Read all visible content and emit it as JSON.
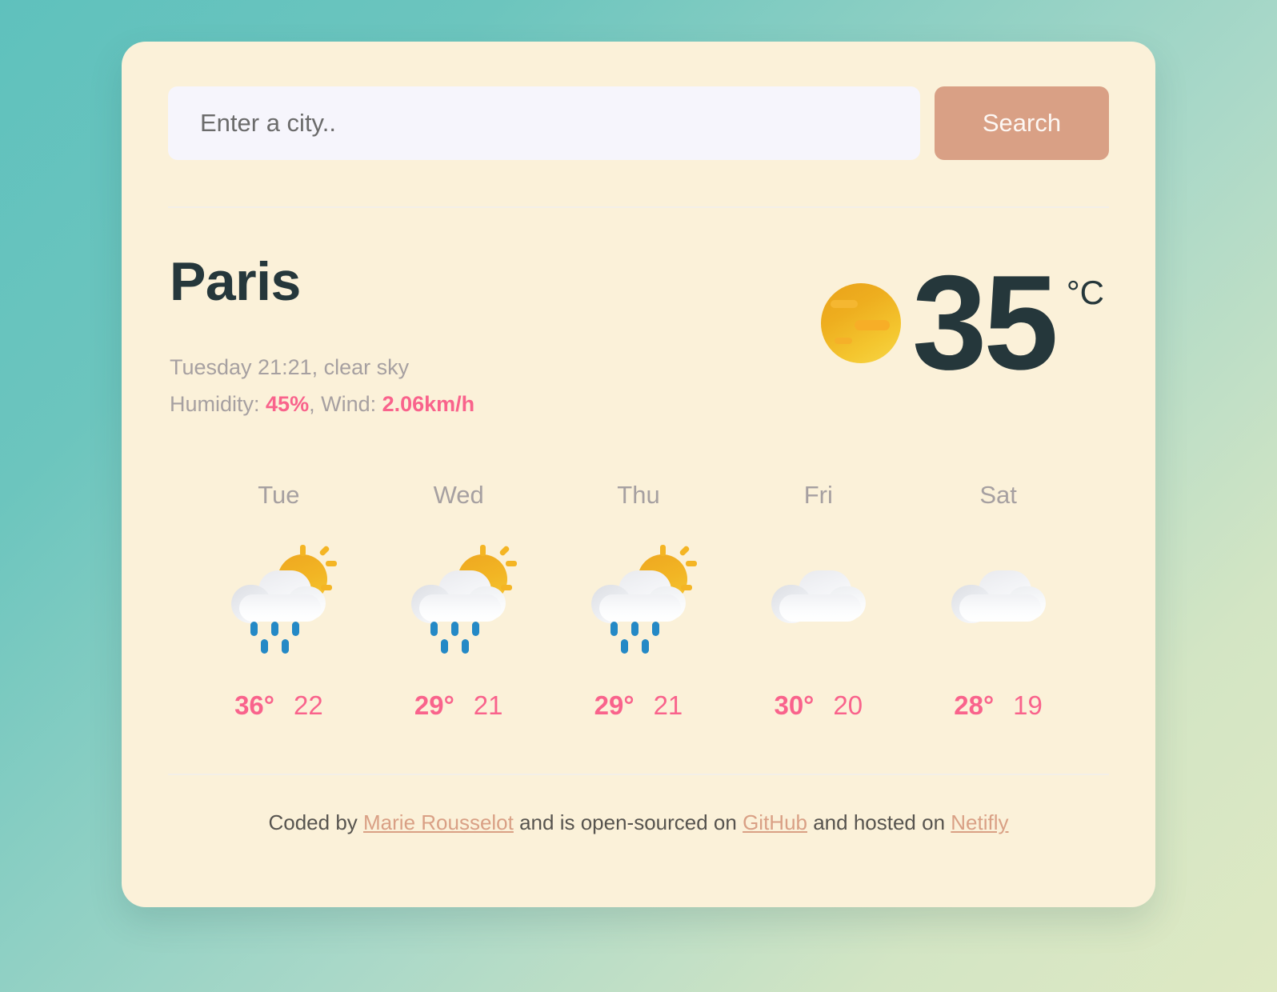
{
  "search": {
    "placeholder": "Enter a city..",
    "value": "",
    "button_label": "Search"
  },
  "current": {
    "city": "Paris",
    "conditions_line": "Tuesday 21:21, clear sky",
    "humidity_label": "Humidity: ",
    "humidity_value": "45%",
    "wind_separator": ", Wind: ",
    "wind_value": "2.06km/h",
    "temperature": "35",
    "unit": "°C",
    "icon": "sun-icon"
  },
  "forecast": {
    "days": [
      {
        "label": "Tue",
        "icon": "sun-behind-rain-cloud-icon",
        "max": "36°",
        "min": "22"
      },
      {
        "label": "Wed",
        "icon": "sun-behind-rain-cloud-icon",
        "max": "29°",
        "min": "21"
      },
      {
        "label": "Thu",
        "icon": "sun-behind-rain-cloud-icon",
        "max": "29°",
        "min": "21"
      },
      {
        "label": "Fri",
        "icon": "cloud-icon",
        "max": "30°",
        "min": "20"
      },
      {
        "label": "Sat",
        "icon": "cloud-icon",
        "max": "28°",
        "min": "19"
      }
    ]
  },
  "footer": {
    "prefix": "Coded by ",
    "author": "Marie Rousselot",
    "middle": " and is open-sourced on ",
    "repo": "GitHub",
    "middle2": " and hosted on ",
    "host": "Netifly"
  },
  "colors": {
    "accent_pink": "#f9638c",
    "button_tan": "#d9a085",
    "card_cream": "#fbf1d9",
    "text_dark": "#25373b",
    "text_muted": "#a6a0a1",
    "background_teal": "#5fc1bd",
    "background_green": "#dfe9c3"
  }
}
